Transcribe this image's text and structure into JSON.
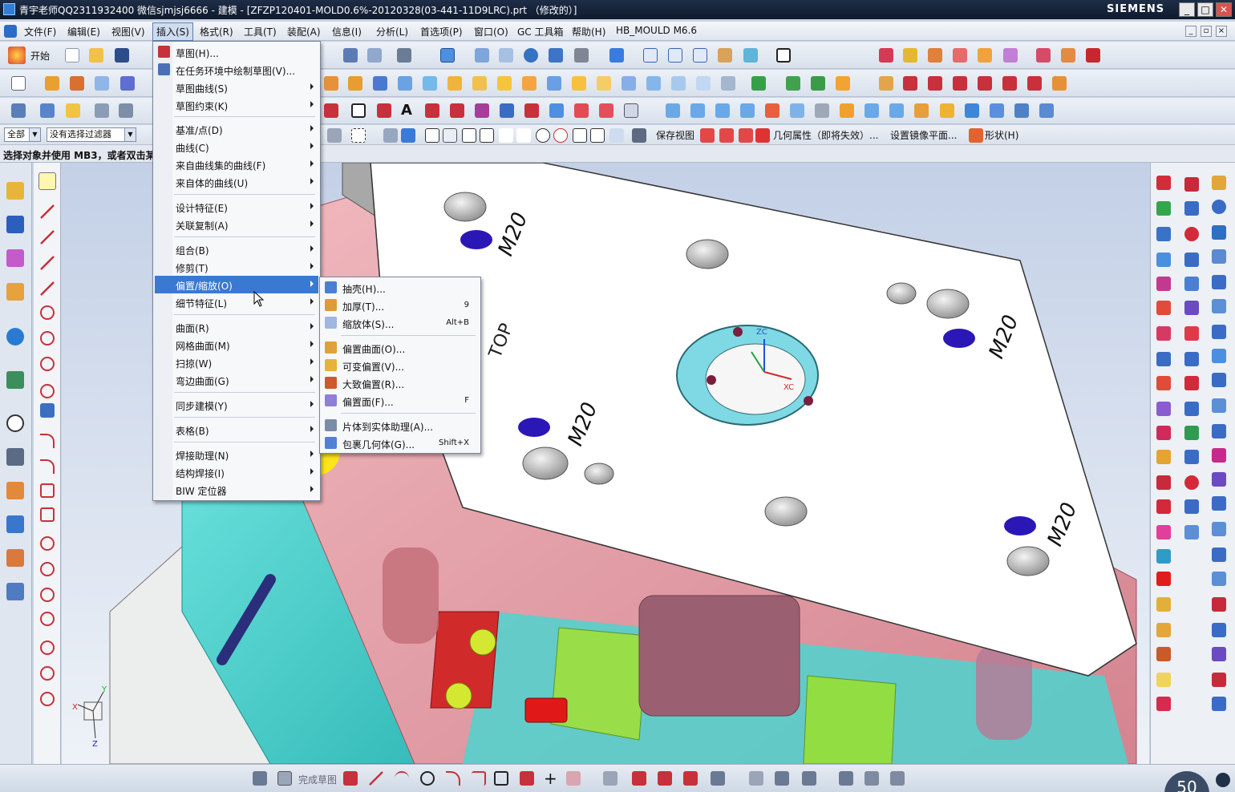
{
  "window": {
    "title": "青宇老师QQ2311932400 微信sjmjsj6666 - 建模 - [ZFZP120401-MOLD0.6%-20120328(03-441-11D9LRC).prt （修改的）]",
    "brand": "SIEMENS",
    "min": "_",
    "max": "□",
    "close": "✕"
  },
  "menubar": {
    "items": [
      "文件(F)",
      "编辑(E)",
      "视图(V)",
      "插入(S)",
      "格式(R)",
      "工具(T)",
      "装配(A)",
      "信息(I)",
      "分析(L)",
      "首选项(P)",
      "窗口(O)",
      "GC 工具箱",
      "帮助(H)",
      "HB_MOULD M6.6"
    ],
    "active_index": 3
  },
  "toolbar": {
    "start_label": "开始",
    "type_filter": "全部",
    "selection_filter": "没有选择过滤器",
    "save_view": "保存视图",
    "geom_props": "几何属性（即将失效）...",
    "mirror_plane": "设置镜像平面...",
    "shape": "形状(H)",
    "finish_sketch": "完成草图"
  },
  "status": {
    "prompt": "选择对象并使用 MB3，或者双击某一对象"
  },
  "insert_menu": {
    "items": [
      {
        "label": "草图(H)...",
        "arrow": false,
        "icon": "sketch-icon"
      },
      {
        "label": "在任务环境中绘制草图(V)...",
        "arrow": false,
        "icon": "task-sketch-icon"
      },
      {
        "label": "草图曲线(S)",
        "arrow": true
      },
      {
        "label": "草图约束(K)",
        "arrow": true
      },
      {
        "label": "基准/点(D)",
        "arrow": true
      },
      {
        "label": "曲线(C)",
        "arrow": true
      },
      {
        "label": "来自曲线集的曲线(F)",
        "arrow": true
      },
      {
        "label": "来自体的曲线(U)",
        "arrow": true
      },
      {
        "label": "设计特征(E)",
        "arrow": true
      },
      {
        "label": "关联复制(A)",
        "arrow": true
      },
      {
        "label": "组合(B)",
        "arrow": true
      },
      {
        "label": "修剪(T)",
        "arrow": true
      },
      {
        "label": "偏置/缩放(O)",
        "arrow": true
      },
      {
        "label": "细节特征(L)",
        "arrow": true
      },
      {
        "label": "曲面(R)",
        "arrow": true
      },
      {
        "label": "网格曲面(M)",
        "arrow": true
      },
      {
        "label": "扫掠(W)",
        "arrow": true
      },
      {
        "label": "弯边曲面(G)",
        "arrow": true
      },
      {
        "label": "同步建模(Y)",
        "arrow": true
      },
      {
        "label": "表格(B)",
        "arrow": true
      },
      {
        "label": "焊接助理(N)",
        "arrow": true
      },
      {
        "label": "结构焊接(I)",
        "arrow": true
      },
      {
        "label": "BIW 定位器",
        "arrow": true
      }
    ],
    "highlighted_index": 12
  },
  "offset_menu": {
    "items": [
      {
        "label": "抽壳(H)...",
        "shortcut": "",
        "icon": "shell-icon"
      },
      {
        "label": "加厚(T)...",
        "shortcut": "9",
        "icon": "thicken-icon"
      },
      {
        "label": "缩放体(S)...",
        "shortcut": "Alt+B",
        "icon": "scale-body-icon"
      },
      {
        "label": "偏置曲面(O)...",
        "shortcut": "",
        "icon": "offset-surface-icon"
      },
      {
        "label": "可变偏置(V)...",
        "shortcut": "",
        "icon": "variable-offset-icon"
      },
      {
        "label": "大致偏置(R)...",
        "shortcut": "",
        "icon": "rough-offset-icon"
      },
      {
        "label": "偏置面(F)...",
        "shortcut": "F",
        "icon": "offset-face-icon"
      },
      {
        "label": "片体到实体助理(A)...",
        "shortcut": "",
        "icon": "sheet-to-solid-icon"
      },
      {
        "label": "包裹几何体(G)...",
        "shortcut": "Shift+X",
        "icon": "wrap-geometry-icon"
      }
    ]
  },
  "viewport": {
    "labels": [
      "M20",
      "M20",
      "M20",
      "M20",
      "TOP",
      "ZC",
      "XC"
    ],
    "triad": [
      "X",
      "Y",
      "Z"
    ]
  },
  "zoom_badge": "50",
  "colors": {
    "plate_top": "#ffffff",
    "plate_side": "#a9a9a9",
    "mold_pink": "#e7a2aa",
    "mold_cyan": "#4fd6d3",
    "hole_blue": "#2b17b6",
    "menu_highlight": "#3a79d1",
    "ring": "#7ed9e4"
  }
}
